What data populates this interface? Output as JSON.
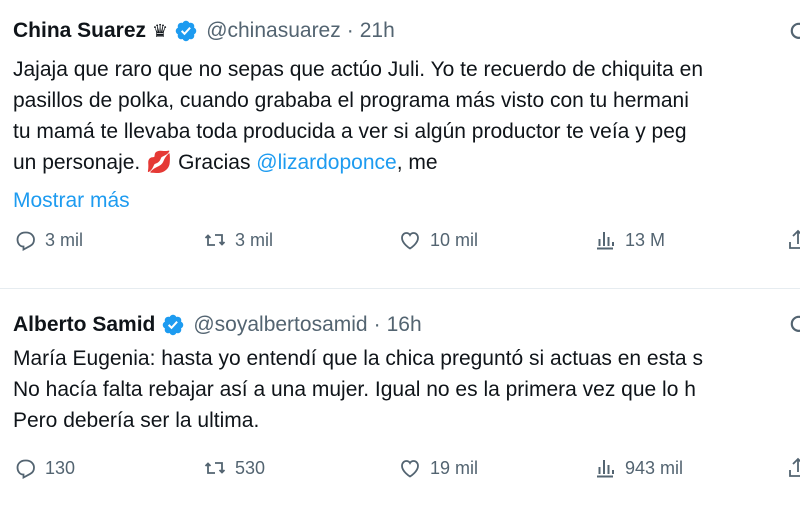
{
  "tweets": [
    {
      "name": "China Suarez",
      "crown": "♛",
      "handle": "@chinasuarez",
      "separator": "·",
      "time": "21h",
      "lines": [
        [
          "Jajaja que raro que no sepas que actúo Juli. Yo te recuerdo de chiquita en"
        ],
        [
          "pasillos de polka, cuando grababa el programa más visto con tu hermani"
        ],
        [
          "tu mamá te llevaba toda producida a ver si algún productor te veía y peg"
        ]
      ],
      "last_line_prefix": "un personaje. ",
      "emoji": "💋",
      "last_line_middle": " Gracias ",
      "mention": "@lizardoponce",
      "last_line_suffix": ", me",
      "show_more": "Mostrar más",
      "replies": "3 mil",
      "retweets": "3 mil",
      "likes": "10 mil",
      "views": "13 M"
    },
    {
      "name": "Alberto Samid",
      "handle": "@soyalbertosamid",
      "separator": "·",
      "time": "16h",
      "lines": [
        [
          "María Eugenia: hasta yo entendí que la chica preguntó si actuas en esta s"
        ],
        [
          "No hacía falta rebajar así a una mujer. Igual no es la primera vez que lo h"
        ],
        [
          "Pero debería ser la ultima."
        ]
      ],
      "replies": "130",
      "retweets": "530",
      "likes": "19 mil",
      "views": "943 mil"
    }
  ],
  "colors": {
    "text": "#0f1419",
    "secondary": "#536471",
    "link": "#1d9bf0",
    "verified": "#1d9bf0",
    "divider": "#e6ecf0"
  },
  "icons": [
    "verified-badge-icon",
    "more-icon",
    "reply-icon",
    "retweet-icon",
    "like-icon",
    "views-icon",
    "share-icon"
  ]
}
